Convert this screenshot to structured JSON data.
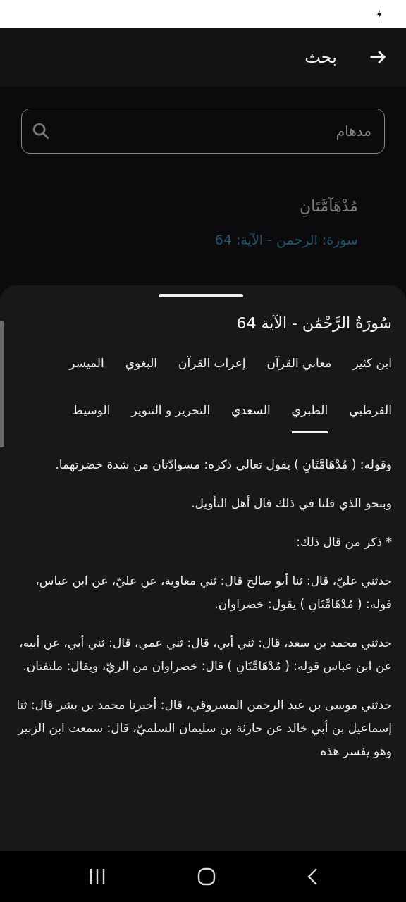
{
  "header": {
    "title": "بحث"
  },
  "search": {
    "value": "مدهام"
  },
  "results": [
    {
      "word": "مُدْهَآمَّتَانِ",
      "reference": "سورة: الرحمن - الآية: 64"
    }
  ],
  "sheet": {
    "title": "سُورَةُ الرَّحْمَٰن - الآية 64",
    "tabs": [
      {
        "label": "ابن كثير",
        "selected": false
      },
      {
        "label": "معاني القرآن",
        "selected": false
      },
      {
        "label": "إعراب القرآن",
        "selected": false
      },
      {
        "label": "البغوي",
        "selected": false
      },
      {
        "label": "الميسر",
        "selected": false
      },
      {
        "label": "القرطبي",
        "selected": false
      },
      {
        "label": "الطبري",
        "selected": true
      },
      {
        "label": "السعدي",
        "selected": false
      },
      {
        "label": "التحرير و التنوير",
        "selected": false
      },
      {
        "label": "الوسيط",
        "selected": false
      }
    ],
    "paragraphs": [
      "وقوله: ( مُدْهَامَّتَانِ ) يقول تعالى ذكره: مسوادّتان من شدة خضرتهما.",
      "وبنحو الذي قلنا في ذلك قال أهل التأويل.",
      "* ذكر من قال ذلك:",
      "حدثني عليّ، قال: ثنا أبو صالح قال: ثني معاوية، عن عليّ، عن ابن عباس، قوله: ( مُدْهَامَّتَانِ ) يقول: خضراوان.",
      "حدثني محمد بن سعد، قال: ثني أبي، قال: ثني عمي، قال: ثني أبي، عن أبيه، عن ابن عباس قوله: ( مُدْهَامَّتَانِ ) قال: خضراوان من الريّ، ويقال: ملتفتان.",
      "حدثني موسى بن عبد الرحمن المسروقي، قال: أخبرنا محمد بن بشر قال: ثنا إسماعيل بن أبي خالد عن حارثة بن سليمان السلميّ، قال: سمعت ابن الزبير وهو يفسر هذه"
    ]
  }
}
